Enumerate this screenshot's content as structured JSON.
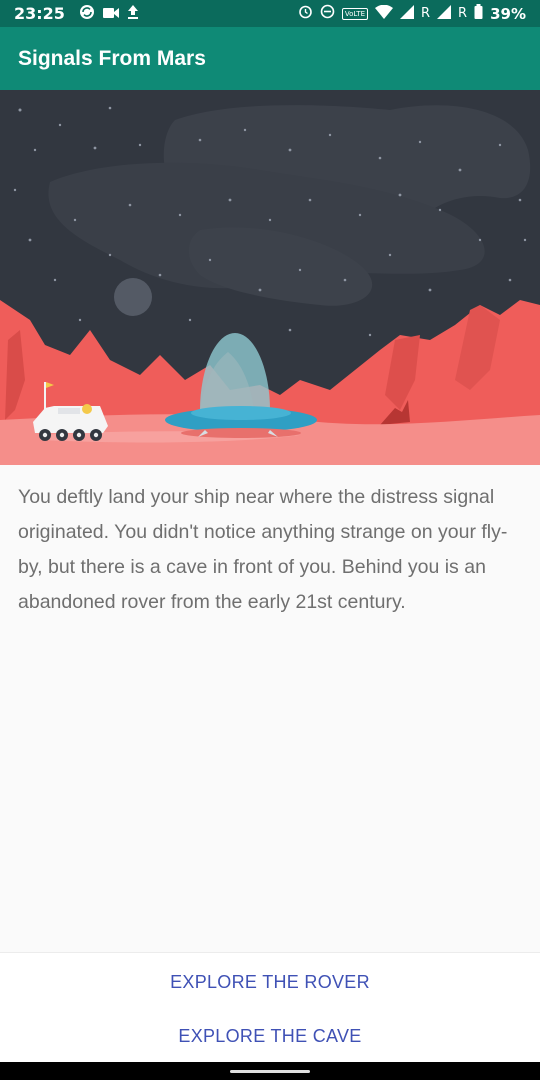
{
  "status_bar": {
    "time": "23:25",
    "signal_label_1": "R",
    "signal_label_2": "R",
    "battery": "39%",
    "volte": "VoLTE",
    "icons": [
      "sync-icon",
      "video-icon",
      "upload-icon",
      "alarm-icon",
      "dnd-icon",
      "volte-icon",
      "wifi-icon",
      "signal-icon",
      "battery-icon"
    ]
  },
  "app_bar": {
    "title": "Signals From Mars"
  },
  "hero": {
    "icons": [
      "rover-icon",
      "spaceship-icon",
      "planet-icon",
      "flag-icon"
    ],
    "colors": {
      "sky": "#323740",
      "nebula": "#3c414a",
      "mountain": "#ef5d5a",
      "ground": "#f58e8a",
      "ship": "#2f9fc4",
      "dome": "#7fbcc4"
    }
  },
  "story": {
    "text": "You deftly land your ship near where the distress signal originated. You didn't notice anything strange on your fly-by, but there is a cave in front of you. Behind you is an abandoned rover from the early 21st century."
  },
  "actions": {
    "explore_rover": "EXPLORE THE ROVER",
    "explore_cave": "EXPLORE THE CAVE"
  },
  "colors": {
    "app_bar": "#0f8a76",
    "status_bar": "#0b6b5c",
    "button_text": "#3f51b5"
  }
}
